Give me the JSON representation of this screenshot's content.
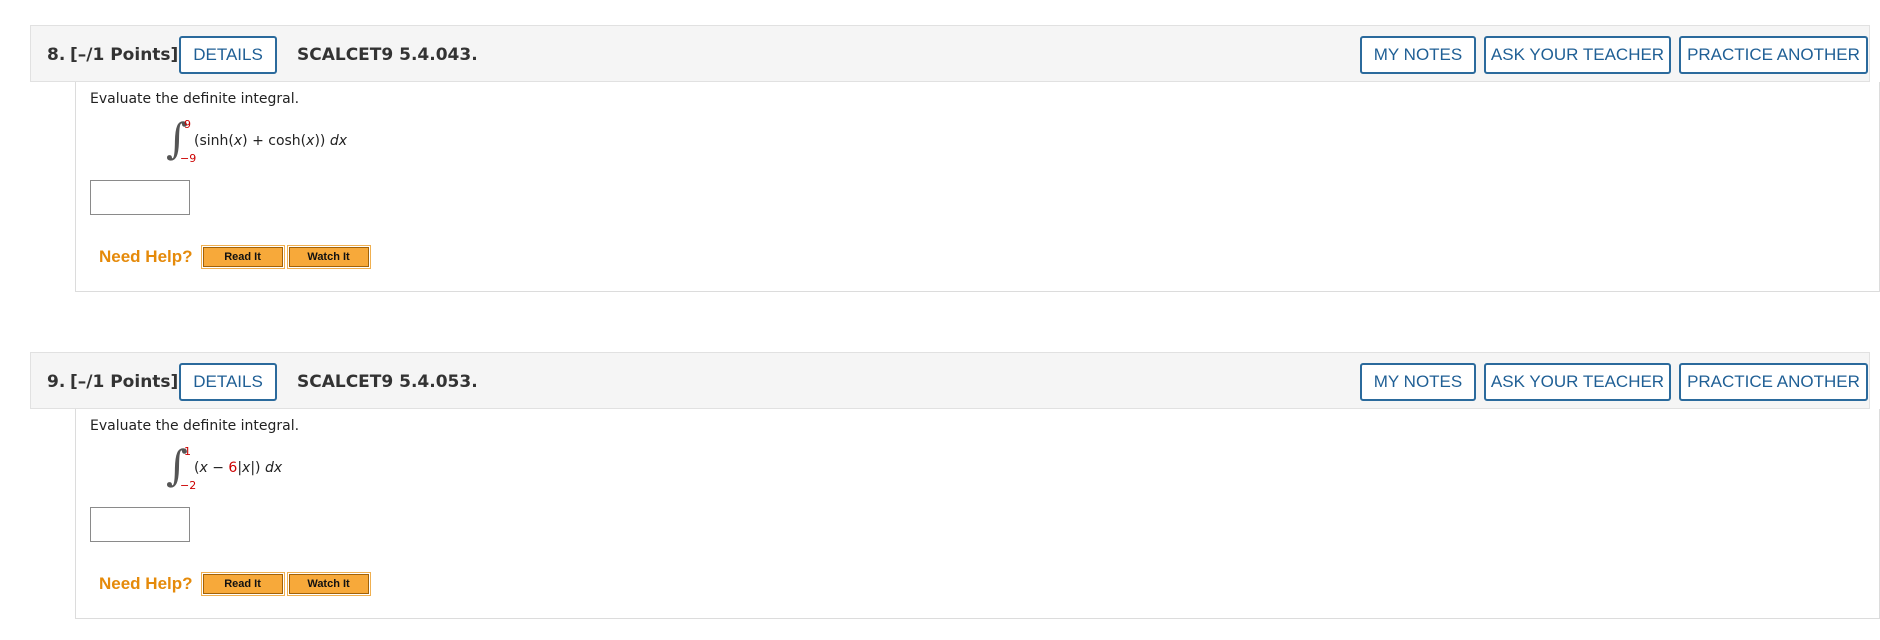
{
  "questions": [
    {
      "number": "8.",
      "points": "[–/1 Points]",
      "details_label": "DETAILS",
      "id": "SCALCET9 5.4.043.",
      "my_notes_label": "MY NOTES",
      "ask_teacher_label": "ASK YOUR TEACHER",
      "practice_label": "PRACTICE ANOTHER",
      "prompt": "Evaluate the definite integral.",
      "upper_limit": "9",
      "lower_limit": "−9",
      "integrand": {
        "open": "(sinh(",
        "var1": "x",
        "mid": ") + cosh(",
        "var2": "x",
        "close": ")) ",
        "dx": "dx"
      },
      "answer_value": "",
      "need_help_label": "Need Help?",
      "read_it_label": "Read It",
      "watch_it_label": "Watch It"
    },
    {
      "number": "9.",
      "points": "[–/1 Points]",
      "details_label": "DETAILS",
      "id": "SCALCET9 5.4.053.",
      "my_notes_label": "MY NOTES",
      "ask_teacher_label": "ASK YOUR TEACHER",
      "practice_label": "PRACTICE ANOTHER",
      "prompt": "Evaluate the definite integral.",
      "upper_limit": "1",
      "lower_limit": "−2",
      "integrand": {
        "open": "(",
        "var1": "x",
        "minus": " − ",
        "coef": "6",
        "abs_open": "|",
        "var2": "x",
        "abs_close": "|) ",
        "dx": "dx"
      },
      "answer_value": "",
      "need_help_label": "Need Help?",
      "read_it_label": "Read It",
      "watch_it_label": "Watch It"
    }
  ],
  "colors": {
    "button_border": "#2b6a9c",
    "button_text": "#1f5f95",
    "limit_red": "#cc0000",
    "help_orange": "#e58a0a",
    "help_button_fill": "#f7a93a"
  }
}
